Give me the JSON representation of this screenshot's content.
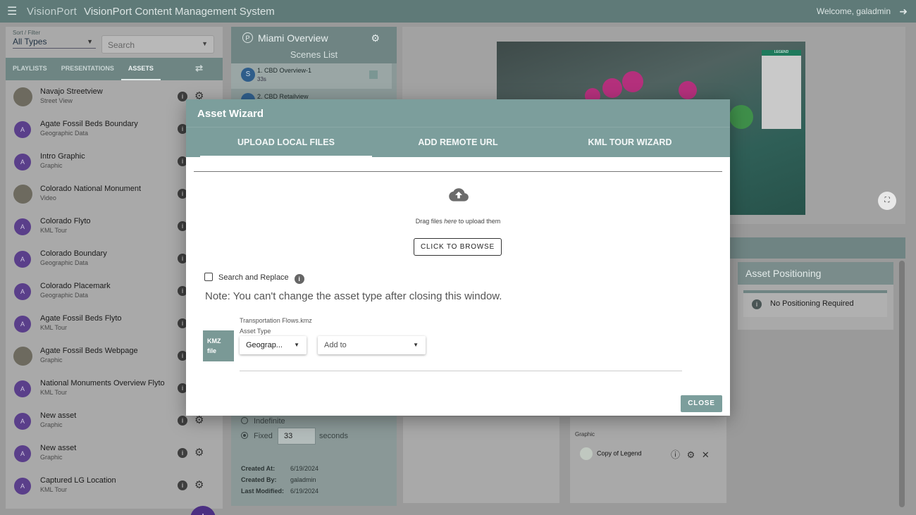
{
  "topbar": {
    "logo": "VisionPort",
    "title": "VisionPort Content Management System",
    "welcome": "Welcome, galadmin"
  },
  "left": {
    "filter_label": "Sort / Filter",
    "filter_value": "All Types",
    "search_placeholder": "Search",
    "tabs": [
      "PLAYLISTS",
      "PRESENTATIONS",
      "ASSETS"
    ],
    "assets": [
      {
        "name": "Navajo Streetview",
        "type": "Street View",
        "avatar": ""
      },
      {
        "name": "Agate Fossil Beds Boundary",
        "type": "Geographic Data",
        "avatar": "A"
      },
      {
        "name": "Intro Graphic",
        "type": "Graphic",
        "avatar": "A"
      },
      {
        "name": "Colorado National Monument",
        "type": "Video",
        "avatar": ""
      },
      {
        "name": "Colorado Flyto",
        "type": "KML Tour",
        "avatar": "A"
      },
      {
        "name": "Colorado Boundary",
        "type": "Geographic Data",
        "avatar": "A"
      },
      {
        "name": "Colorado Placemark",
        "type": "Geographic Data",
        "avatar": "A"
      },
      {
        "name": "Agate Fossil Beds Flyto",
        "type": "KML Tour",
        "avatar": "A"
      },
      {
        "name": "Agate Fossil Beds Webpage",
        "type": "Graphic",
        "avatar": ""
      },
      {
        "name": "National Monuments Overview Flyto",
        "type": "KML Tour",
        "avatar": "A"
      },
      {
        "name": "New asset",
        "type": "Graphic",
        "avatar": "A"
      },
      {
        "name": "New asset",
        "type": "Graphic",
        "avatar": "A"
      },
      {
        "name": "Captured LG Location",
        "type": "KML Tour",
        "avatar": "A"
      }
    ]
  },
  "mid": {
    "badge": "P",
    "title": "Miami Overview",
    "subtitle": "Scenes List",
    "scene1": {
      "badge": "S",
      "name": "1. CBD Overview-1",
      "duration": "33s"
    },
    "scene2": {
      "name": "2. CBD Retailview"
    },
    "duration_indefinite": "Indefinite",
    "duration_fixed": "Fixed",
    "seconds_value": "33",
    "seconds_label": "seconds",
    "created_at_label": "Created At:",
    "created_at": "6/19/2024",
    "created_by_label": "Created By:",
    "created_by": "galadmin",
    "modified_label": "Last Modified:",
    "modified": "6/19/2024"
  },
  "right": {
    "map_legend": "LEGEND",
    "asset_positioning": "Asset Positioning",
    "no_positioning": "No Positioning Required",
    "graphic_label": "Graphic",
    "graphic_item": "Copy of Legend"
  },
  "dialog": {
    "title": "Asset Wizard",
    "tabs": [
      "UPLOAD LOCAL FILES",
      "ADD REMOTE URL",
      "KML TOUR WIZARD"
    ],
    "drag_pre": "Drag files ",
    "drag_em": "here",
    "drag_post": " to upload them",
    "browse": "CLICK TO BROWSE",
    "search_replace": "Search and Replace",
    "note": "Note: You can't change the asset type after closing this window.",
    "file_badge_1": "KMZ",
    "file_badge_2": "file",
    "file_name": "Transportation Flows.kmz",
    "asset_type_label": "Asset Type",
    "asset_type_value": "Geograp...",
    "add_to_placeholder": "Add to",
    "close": "CLOSE"
  }
}
